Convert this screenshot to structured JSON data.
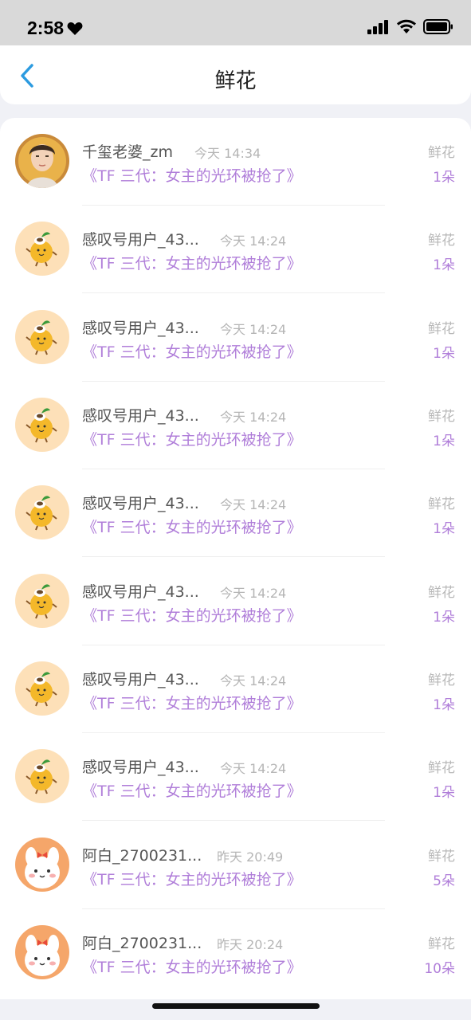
{
  "status_bar": {
    "time": "2:58",
    "icons": [
      "heart-icon",
      "signal-icon",
      "wifi-icon",
      "battery-icon"
    ]
  },
  "nav": {
    "back_icon": "chevron-left-icon",
    "title": "鲜花"
  },
  "colors": {
    "accent_purple": "#b07ed9",
    "back_blue": "#2c9be0"
  },
  "rows": [
    {
      "name": "千玺老婆_zm",
      "time": "今天 14:34",
      "book": "《TF 三代：女主的光环被抢了》",
      "gift": "鲜花",
      "count": "1朵",
      "avatar": "portrait"
    },
    {
      "name": "感叹号用户_43...",
      "time": "今天 14:24",
      "book": "《TF 三代：女主的光环被抢了》",
      "gift": "鲜花",
      "count": "1朵",
      "avatar": "orange-mascot"
    },
    {
      "name": "感叹号用户_43...",
      "time": "今天 14:24",
      "book": "《TF 三代：女主的光环被抢了》",
      "gift": "鲜花",
      "count": "1朵",
      "avatar": "orange-mascot"
    },
    {
      "name": "感叹号用户_43...",
      "time": "今天 14:24",
      "book": "《TF 三代：女主的光环被抢了》",
      "gift": "鲜花",
      "count": "1朵",
      "avatar": "orange-mascot"
    },
    {
      "name": "感叹号用户_43...",
      "time": "今天 14:24",
      "book": "《TF 三代：女主的光环被抢了》",
      "gift": "鲜花",
      "count": "1朵",
      "avatar": "orange-mascot"
    },
    {
      "name": "感叹号用户_43...",
      "time": "今天 14:24",
      "book": "《TF 三代：女主的光环被抢了》",
      "gift": "鲜花",
      "count": "1朵",
      "avatar": "orange-mascot"
    },
    {
      "name": "感叹号用户_43...",
      "time": "今天 14:24",
      "book": "《TF 三代：女主的光环被抢了》",
      "gift": "鲜花",
      "count": "1朵",
      "avatar": "orange-mascot"
    },
    {
      "name": "感叹号用户_43...",
      "time": "今天 14:24",
      "book": "《TF 三代：女主的光环被抢了》",
      "gift": "鲜花",
      "count": "1朵",
      "avatar": "orange-mascot"
    },
    {
      "name": "阿白_2700231...",
      "time": "昨天 20:49",
      "book": "《TF 三代：女主的光环被抢了》",
      "gift": "鲜花",
      "count": "5朵",
      "avatar": "bunny"
    },
    {
      "name": "阿白_2700231...",
      "time": "昨天 20:24",
      "book": "《TF 三代：女主的光环被抢了》",
      "gift": "鲜花",
      "count": "10朵",
      "avatar": "bunny"
    }
  ]
}
